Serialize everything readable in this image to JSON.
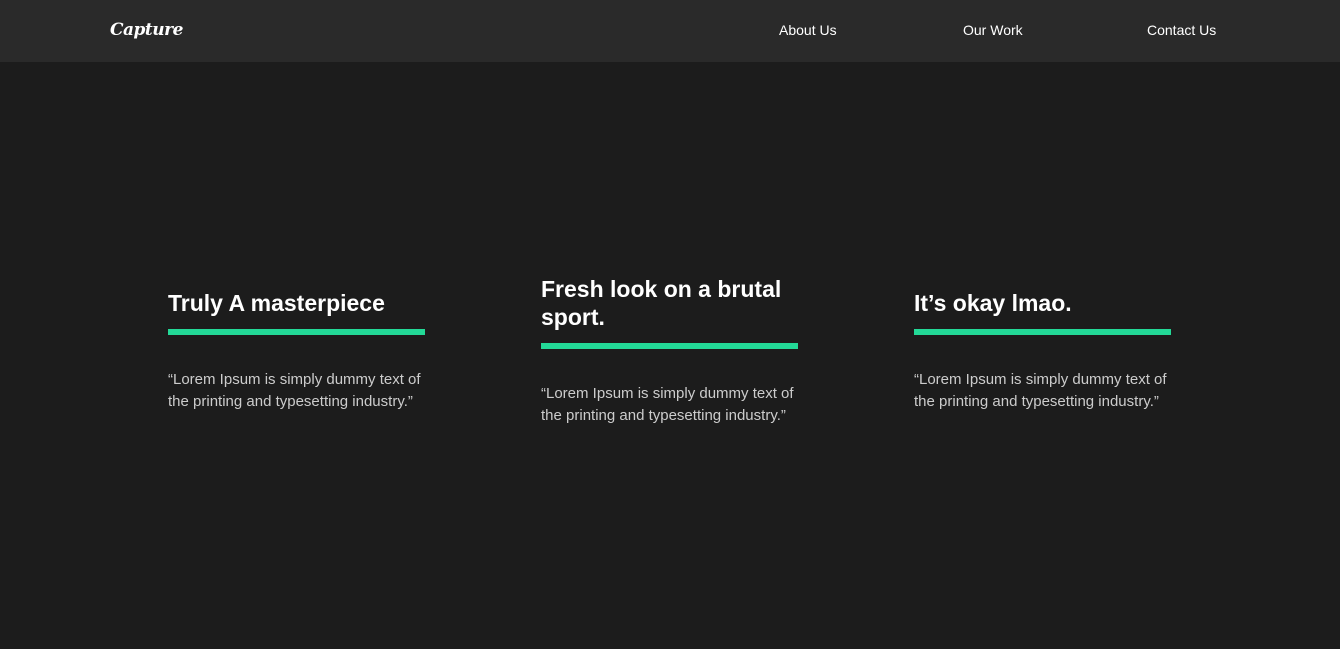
{
  "header": {
    "logo": "Capture",
    "nav": [
      {
        "label": "About Us"
      },
      {
        "label": "Our Work"
      },
      {
        "label": "Contact Us"
      }
    ]
  },
  "reviews": [
    {
      "title": "Truly A masterpiece",
      "text": "“Lorem Ipsum is simply dummy text of the printing and typesetting industry.”"
    },
    {
      "title": "Fresh look on a brutal sport.",
      "text": "“Lorem Ipsum is simply dummy text of the printing and typesetting industry.”"
    },
    {
      "title": "It’s okay lmao.",
      "text": "“Lorem Ipsum is simply dummy text of the printing and typesetting industry.”"
    }
  ],
  "colors": {
    "background": "#1c1c1c",
    "header": "#2a2a2a",
    "accent": "#23d997",
    "text": "#ffffff",
    "body_text": "#cccccc"
  }
}
